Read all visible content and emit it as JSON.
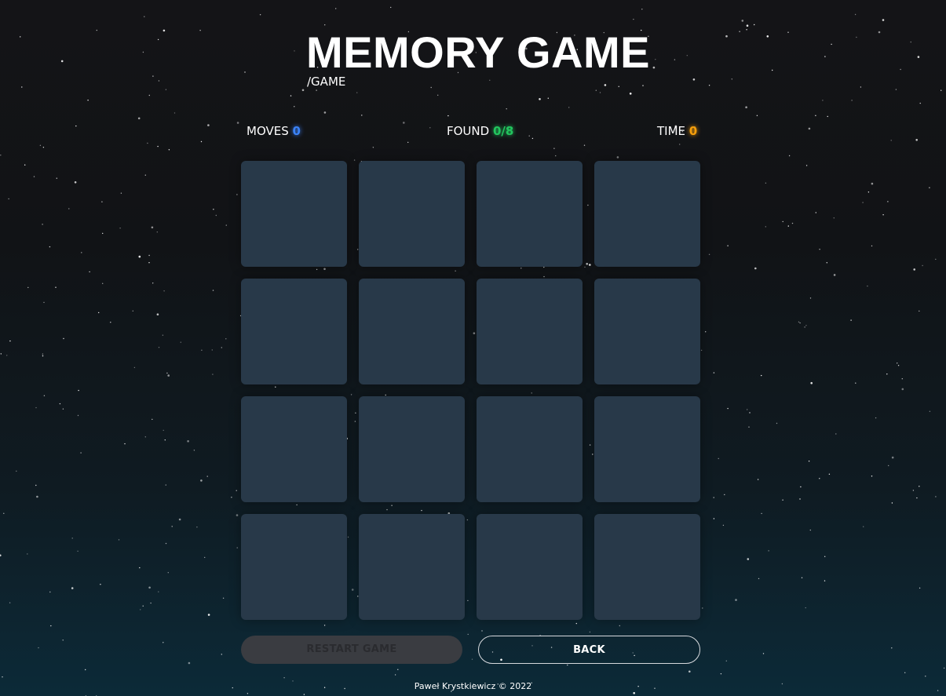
{
  "header": {
    "title": "MEMORY GAME",
    "subtitle": "/GAME"
  },
  "stats": {
    "moves_label": "MOVES",
    "moves_value": "0",
    "found_label": "FOUND",
    "found_value": "0/8",
    "time_label": "TIME",
    "time_value": "0"
  },
  "colors": {
    "moves_accent": "#3b82f6",
    "found_accent": "#22c55e",
    "time_accent": "#f59e0b",
    "card_back": "#283949"
  },
  "board": {
    "rows": 4,
    "columns": 4,
    "face_down_cards": 16
  },
  "actions": {
    "restart_label": "RESTART GAME",
    "back_label": "BACK"
  },
  "footer": {
    "credit": "Paweł Krystkiewicz © 2022"
  }
}
